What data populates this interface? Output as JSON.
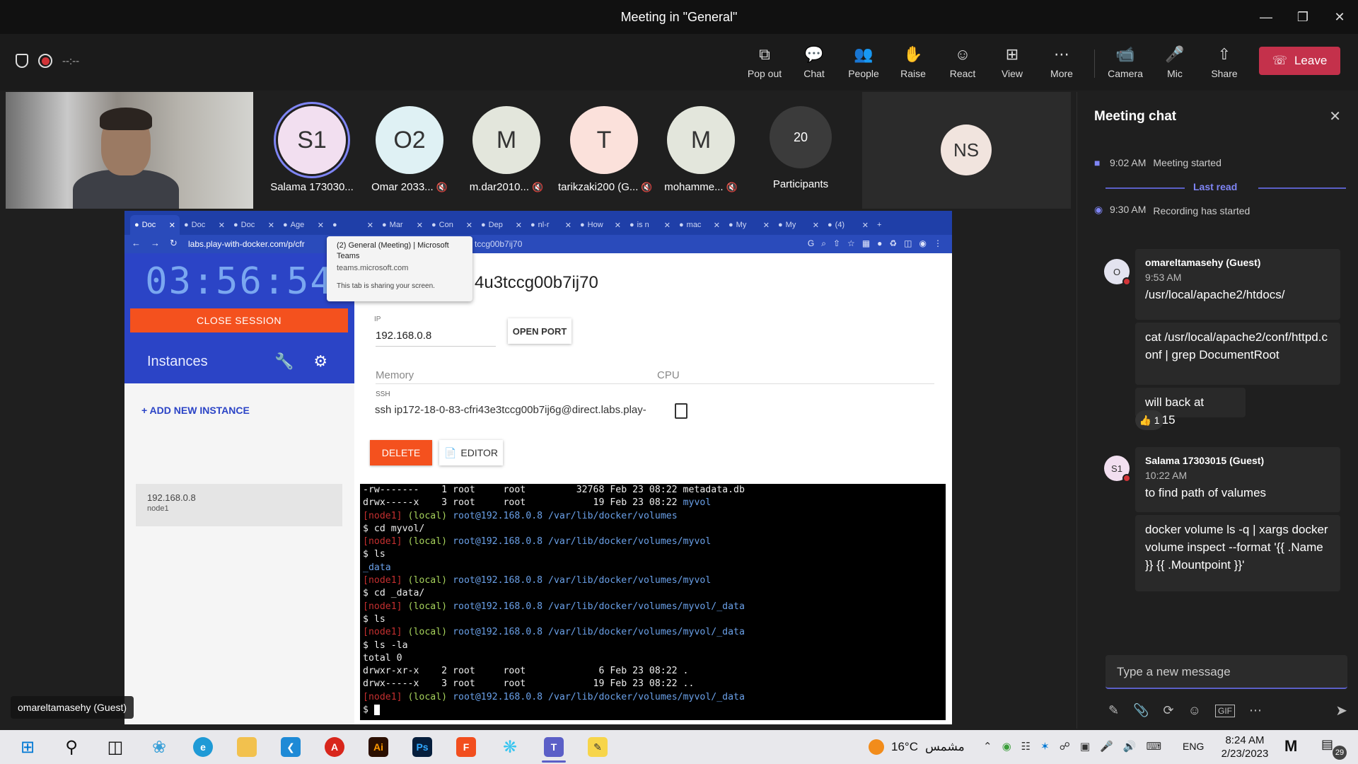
{
  "window": {
    "title": "Meeting in \"General\""
  },
  "meeting_bar": {
    "timer": "--:--",
    "buttons": [
      {
        "label": "Pop out",
        "icon": "pop-out-icon"
      },
      {
        "label": "Chat",
        "icon": "chat-icon"
      },
      {
        "label": "People",
        "icon": "people-icon"
      },
      {
        "label": "Raise",
        "icon": "raise-hand-icon"
      },
      {
        "label": "React",
        "icon": "react-icon"
      },
      {
        "label": "View",
        "icon": "view-icon"
      },
      {
        "label": "More",
        "icon": "more-icon"
      },
      {
        "label": "Camera",
        "icon": "camera-off-icon"
      },
      {
        "label": "Mic",
        "icon": "mic-off-icon"
      },
      {
        "label": "Share",
        "icon": "share-icon"
      }
    ],
    "leave_label": "Leave",
    "leave_color": "#c4314b"
  },
  "participants": [
    {
      "initials": "S1",
      "name": "Salama 173030...",
      "color": "#f2dff0",
      "muted": false
    },
    {
      "initials": "O2",
      "name": "Omar 2033...",
      "color": "#dff1f4",
      "muted": true
    },
    {
      "initials": "M",
      "name": "m.dar2010...",
      "color": "#e3e6dc",
      "muted": true
    },
    {
      "initials": "T",
      "name": "tarikzaki200 (G...",
      "color": "#fbe1db",
      "muted": true
    },
    {
      "initials": "M",
      "name": "mohamme...",
      "color": "#e3e6dc",
      "muted": true
    }
  ],
  "participants_count": {
    "value": "20",
    "label": "Participants"
  },
  "ns_tile": {
    "initials": "NS"
  },
  "presenter_badge": "omareltamasehy (Guest)",
  "shared_screen": {
    "browser_tabs": [
      "Doc",
      "Doc",
      "Doc",
      "Age",
      "",
      "Mar",
      "Con",
      "Dep",
      "nl-r",
      "How",
      "is n",
      "mac",
      "My",
      "My",
      "(4)"
    ],
    "address": "labs.play-with-docker.com/p/cfr",
    "address_tail": "tccg00b7ij70",
    "tooltip": {
      "title": "(2) General (Meeting) | Microsoft Teams",
      "domain": "teams.microsoft.com",
      "note": "This tab is sharing your screen."
    },
    "pwd": {
      "clock": "03:56:54",
      "close_session": "CLOSE SESSION",
      "instances": "Instances",
      "add_instance": "+ ADD NEW INSTANCE",
      "instance_ip": "192.168.0.8",
      "instance_name": "node1",
      "host_title": "4u3tccg00b7ij70",
      "ip_label": "IP",
      "ip_value": "192.168.0.8",
      "open_port": "OPEN PORT",
      "memory_label": "Memory",
      "cpu_label": "CPU",
      "ssh_label": "SSH",
      "ssh_value": "ssh ip172-18-0-83-cfri43e3tccg00b7ij6g@direct.labs.play-",
      "delete": "DELETE",
      "editor": "EDITOR"
    },
    "terminal_lines": [
      {
        "t": "plain",
        "text": "-rw-------    1 root     root         32768 Feb 23 08:22 metadata.db"
      },
      {
        "t": "dirline",
        "text": "drwx-----x    3 root     root            19 Feb 23 08:22 ",
        "dir": "myvol"
      },
      {
        "t": "prompt",
        "node": "[node1]",
        "local": "(local)",
        "path": "root@192.168.0.8 /var/lib/docker/volumes"
      },
      {
        "t": "plain",
        "text": "$ cd myvol/"
      },
      {
        "t": "prompt",
        "node": "[node1]",
        "local": "(local)",
        "path": "root@192.168.0.8 /var/lib/docker/volumes/myvol"
      },
      {
        "t": "plain",
        "text": "$ ls"
      },
      {
        "t": "dironly",
        "dir": "_data"
      },
      {
        "t": "prompt",
        "node": "[node1]",
        "local": "(local)",
        "path": "root@192.168.0.8 /var/lib/docker/volumes/myvol"
      },
      {
        "t": "plain",
        "text": "$ cd _data/"
      },
      {
        "t": "prompt",
        "node": "[node1]",
        "local": "(local)",
        "path": "root@192.168.0.8 /var/lib/docker/volumes/myvol/_data"
      },
      {
        "t": "plain",
        "text": "$ ls"
      },
      {
        "t": "prompt",
        "node": "[node1]",
        "local": "(local)",
        "path": "root@192.168.0.8 /var/lib/docker/volumes/myvol/_data"
      },
      {
        "t": "plain",
        "text": "$ ls -la"
      },
      {
        "t": "plain",
        "text": "total 0"
      },
      {
        "t": "plain",
        "text": "drwxr-xr-x    2 root     root             6 Feb 23 08:22 ."
      },
      {
        "t": "plain",
        "text": "drwx-----x    3 root     root            19 Feb 23 08:22 .."
      },
      {
        "t": "prompt",
        "node": "[node1]",
        "local": "(local)",
        "path": "root@192.168.0.8 /var/lib/docker/volumes/myvol/_data"
      },
      {
        "t": "cursor",
        "text": "$ "
      }
    ]
  },
  "chat": {
    "title": "Meeting chat",
    "system": [
      {
        "time": "9:02 AM",
        "text": "Meeting started"
      },
      {
        "time": "9:30 AM",
        "text": "Recording has started"
      }
    ],
    "last_read": "Last read",
    "messages": [
      {
        "author": "omareltamasehy (Guest)",
        "initials": "O",
        "time": "9:53 AM",
        "bubbles": [
          "/usr/local/apache2/htdocs/",
          "cat /usr/local/apache2/conf/httpd.conf | grep DocumentRoot",
          "will back at 10:15"
        ],
        "reaction": "👍 1"
      },
      {
        "author": "Salama 17303015 (Guest)",
        "initials": "S1",
        "time": "10:22 AM",
        "bubbles": [
          "to find path of valumes",
          "docker volume ls -q | xargs docker volume inspect --format '{{ .Name }} {{ .Mountpoint }}'"
        ]
      }
    ],
    "compose_placeholder": "Type a new message"
  },
  "taskbar": {
    "weather_temp": "16°C",
    "weather_text": "مشمس",
    "lang": "ENG",
    "time": "8:24 AM",
    "date": "2/23/2023",
    "notifications": "29"
  }
}
